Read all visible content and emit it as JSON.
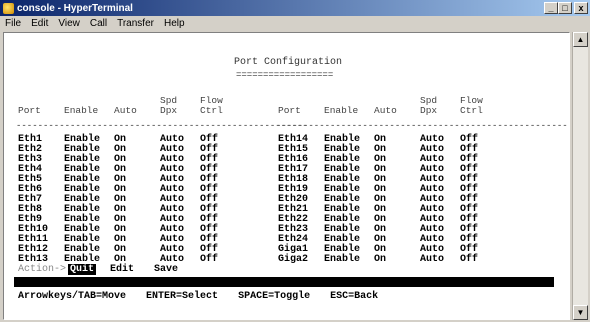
{
  "window": {
    "title": "console - HyperTerminal",
    "controls": [
      "_",
      "□",
      "x"
    ]
  },
  "menu": [
    "File",
    "Edit",
    "View",
    "Call",
    "Transfer",
    "Help"
  ],
  "screen": {
    "title": "Port Configuration",
    "title_underline": "==================",
    "dash_line": "------------------------------------------------------",
    "headers": [
      "Port",
      "Enable",
      "Auto",
      "Spd\nDpx",
      "Flow\nCtrl"
    ],
    "left_rows": [
      [
        "Eth1",
        "Enable",
        "On",
        "Auto",
        "Off"
      ],
      [
        "Eth2",
        "Enable",
        "On",
        "Auto",
        "Off"
      ],
      [
        "Eth3",
        "Enable",
        "On",
        "Auto",
        "Off"
      ],
      [
        "Eth4",
        "Enable",
        "On",
        "Auto",
        "Off"
      ],
      [
        "Eth5",
        "Enable",
        "On",
        "Auto",
        "Off"
      ],
      [
        "Eth6",
        "Enable",
        "On",
        "Auto",
        "Off"
      ],
      [
        "Eth7",
        "Enable",
        "On",
        "Auto",
        "Off"
      ],
      [
        "Eth8",
        "Enable",
        "On",
        "Auto",
        "Off"
      ],
      [
        "Eth9",
        "Enable",
        "On",
        "Auto",
        "Off"
      ],
      [
        "Eth10",
        "Enable",
        "On",
        "Auto",
        "Off"
      ],
      [
        "Eth11",
        "Enable",
        "On",
        "Auto",
        "Off"
      ],
      [
        "Eth12",
        "Enable",
        "On",
        "Auto",
        "Off"
      ],
      [
        "Eth13",
        "Enable",
        "On",
        "Auto",
        "Off"
      ]
    ],
    "right_rows": [
      [
        "Eth14",
        "Enable",
        "On",
        "Auto",
        "Off"
      ],
      [
        "Eth15",
        "Enable",
        "On",
        "Auto",
        "Off"
      ],
      [
        "Eth16",
        "Enable",
        "On",
        "Auto",
        "Off"
      ],
      [
        "Eth17",
        "Enable",
        "On",
        "Auto",
        "Off"
      ],
      [
        "Eth18",
        "Enable",
        "On",
        "Auto",
        "Off"
      ],
      [
        "Eth19",
        "Enable",
        "On",
        "Auto",
        "Off"
      ],
      [
        "Eth20",
        "Enable",
        "On",
        "Auto",
        "Off"
      ],
      [
        "Eth21",
        "Enable",
        "On",
        "Auto",
        "Off"
      ],
      [
        "Eth22",
        "Enable",
        "On",
        "Auto",
        "Off"
      ],
      [
        "Eth23",
        "Enable",
        "On",
        "Auto",
        "Off"
      ],
      [
        "Eth24",
        "Enable",
        "On",
        "Auto",
        "Off"
      ],
      [
        "Giga1",
        "Enable",
        "On",
        "Auto",
        "Off"
      ],
      [
        "Giga2",
        "Enable",
        "On",
        "Auto",
        "Off"
      ]
    ],
    "action_label": "Action->",
    "actions": [
      "Quit",
      "Edit",
      "Save"
    ],
    "help": [
      "Arrowkeys/TAB=Move",
      "ENTER=Select",
      "SPACE=Toggle",
      "ESC=Back"
    ]
  }
}
